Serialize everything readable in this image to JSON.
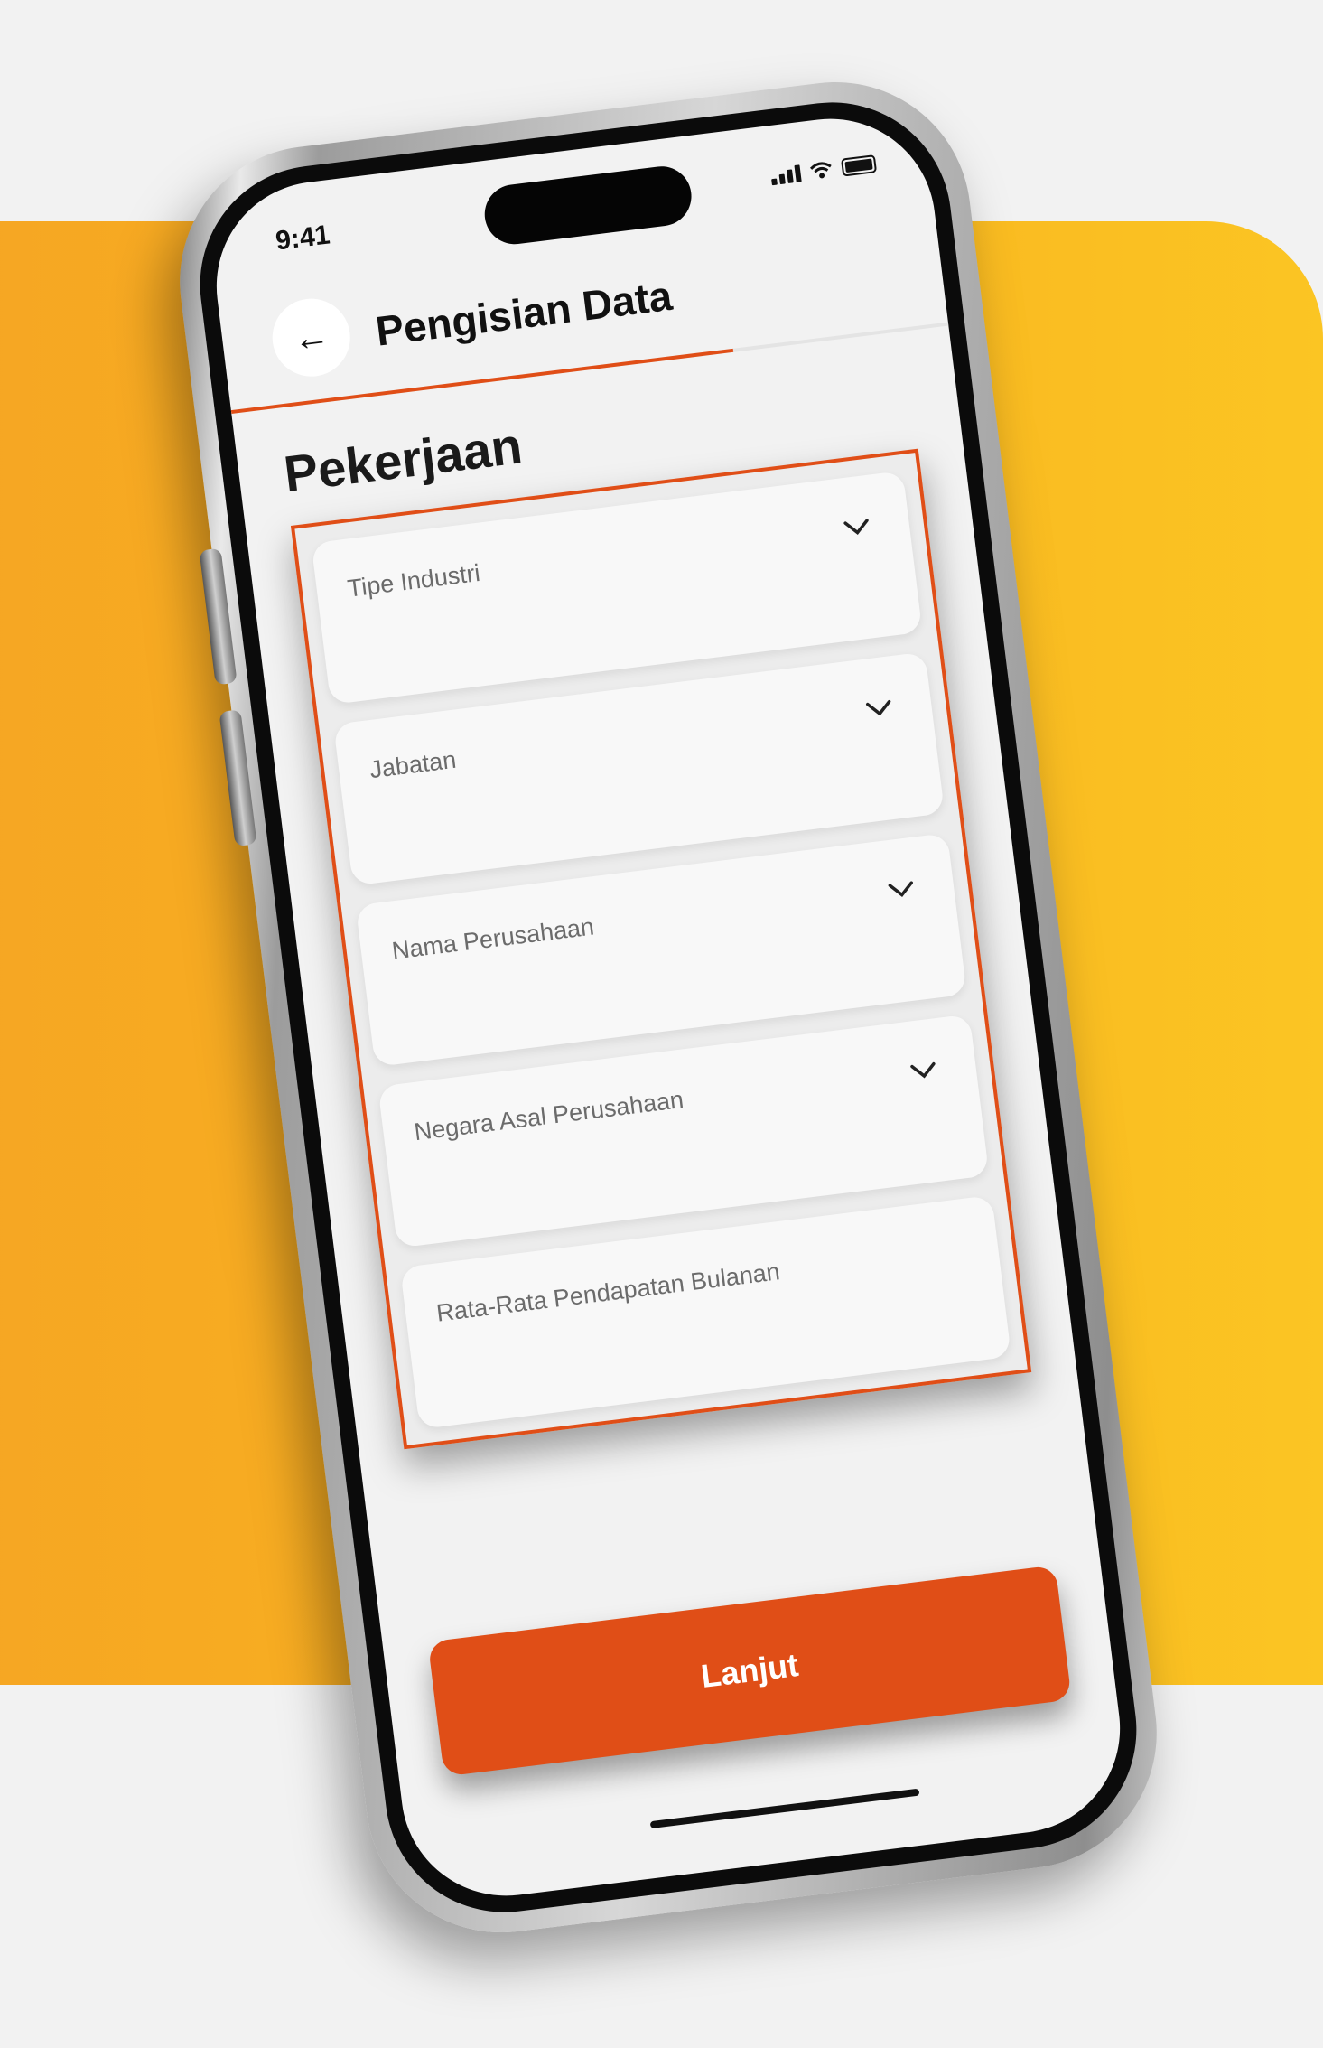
{
  "status_bar": {
    "time": "9:41"
  },
  "header": {
    "back_icon": "←",
    "title": "Pengisian Data"
  },
  "progress": {
    "fraction": 0.7
  },
  "section": {
    "title": "Pekerjaan"
  },
  "form": {
    "fields": [
      {
        "label": "Tipe Industri",
        "has_dropdown": true
      },
      {
        "label": "Jabatan",
        "has_dropdown": true
      },
      {
        "label": "Nama Perusahaan",
        "has_dropdown": true
      },
      {
        "label": "Negara Asal Perusahaan",
        "has_dropdown": true
      },
      {
        "label": "Rata-Rata Pendapatan Bulanan",
        "has_dropdown": false
      }
    ]
  },
  "cta": {
    "label": "Lanjut"
  },
  "colors": {
    "accent": "#e04e17",
    "background_yellow": "#f9b420"
  }
}
